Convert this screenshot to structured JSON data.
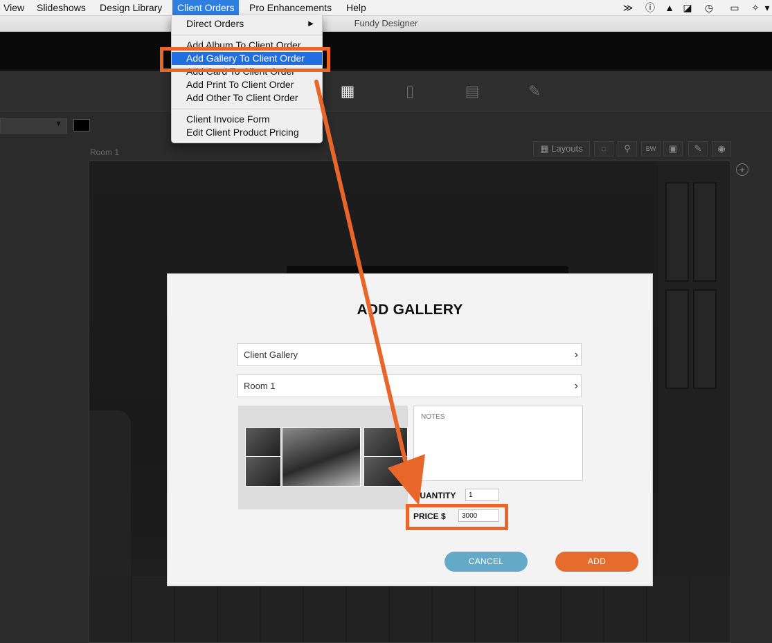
{
  "menubar": {
    "items": [
      "View",
      "Slideshows",
      "Design Library",
      "Client Orders",
      "Pro Enhancements",
      "Help"
    ]
  },
  "window": {
    "title": "Fundy Designer"
  },
  "room_label": "Room 1",
  "layouts_label": "Layouts",
  "bw_label": "BW",
  "dropdown": {
    "direct_orders": "Direct Orders",
    "add_album": "Add Album To Client Order",
    "add_gallery": "Add Gallery To Client Order",
    "add_card": "Add Card To Client Order",
    "add_print": "Add Print To Client Order",
    "add_other": "Add Other To Client Order",
    "client_invoice": "Client Invoice Form",
    "edit_pricing": "Edit Client Product Pricing"
  },
  "dialog": {
    "title": "ADD GALLERY",
    "product_select": "Client Gallery",
    "room_select": "Room 1",
    "notes_placeholder": "NOTES",
    "quantity_label": "QUANTITY",
    "quantity_value": "1",
    "price_label": "PRICE $",
    "price_value": "3000",
    "cancel_label": "CANCEL",
    "add_label": "ADD"
  },
  "colors": {
    "highlight": "#e8662a",
    "menu_selection": "#1f6fe0",
    "cancel": "#64a9c6",
    "add": "#e56c2d"
  },
  "icons": [
    "back-forward-icon",
    "info-circle-icon",
    "warning-icon",
    "drive-icon",
    "time-machine-icon",
    "airplay-icon",
    "bluetooth-icon"
  ]
}
